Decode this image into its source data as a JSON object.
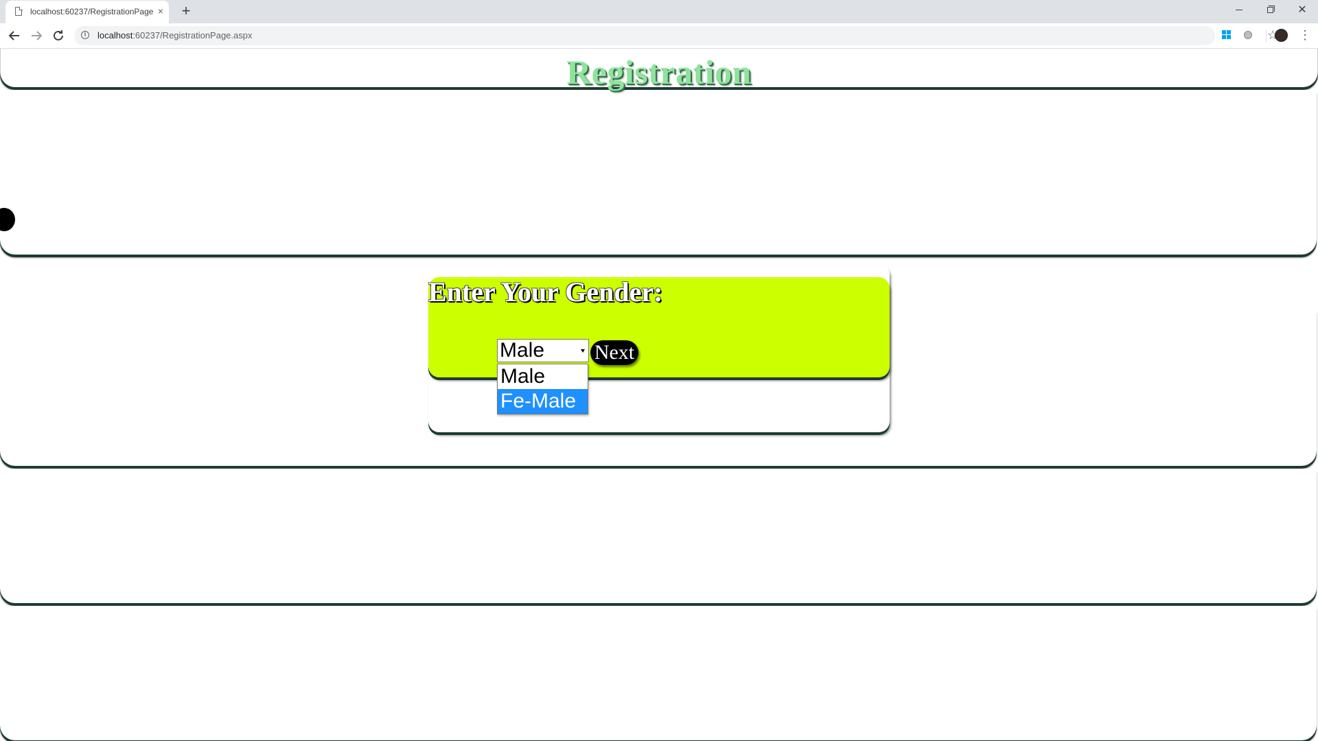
{
  "browser": {
    "tab_title": "localhost:60237/RegistrationPage",
    "tab_close": "×",
    "new_tab": "+",
    "url_host": "localhost",
    "url_path": ":60237/RegistrationPage.aspx",
    "icons": [
      "page-icon",
      "close-icon",
      "plus-icon",
      "back-icon",
      "forward-icon",
      "reload-icon",
      "info-icon",
      "star-icon",
      "windows-extension-icon",
      "extension-icon",
      "profile-avatar",
      "menu-icon",
      "minimize-icon",
      "maximize-icon",
      "window-close-icon"
    ]
  },
  "page": {
    "title": "Registration",
    "title_color": "#8fe39c"
  },
  "form": {
    "label": "Enter Your Gender:",
    "panel_color": "#ccff00",
    "selected_value": "Male",
    "options": [
      "Male",
      "Fe-Male"
    ],
    "highlighted_option": "Fe-Male",
    "highlight_color": "#1e90ff",
    "next_label": "Next"
  }
}
